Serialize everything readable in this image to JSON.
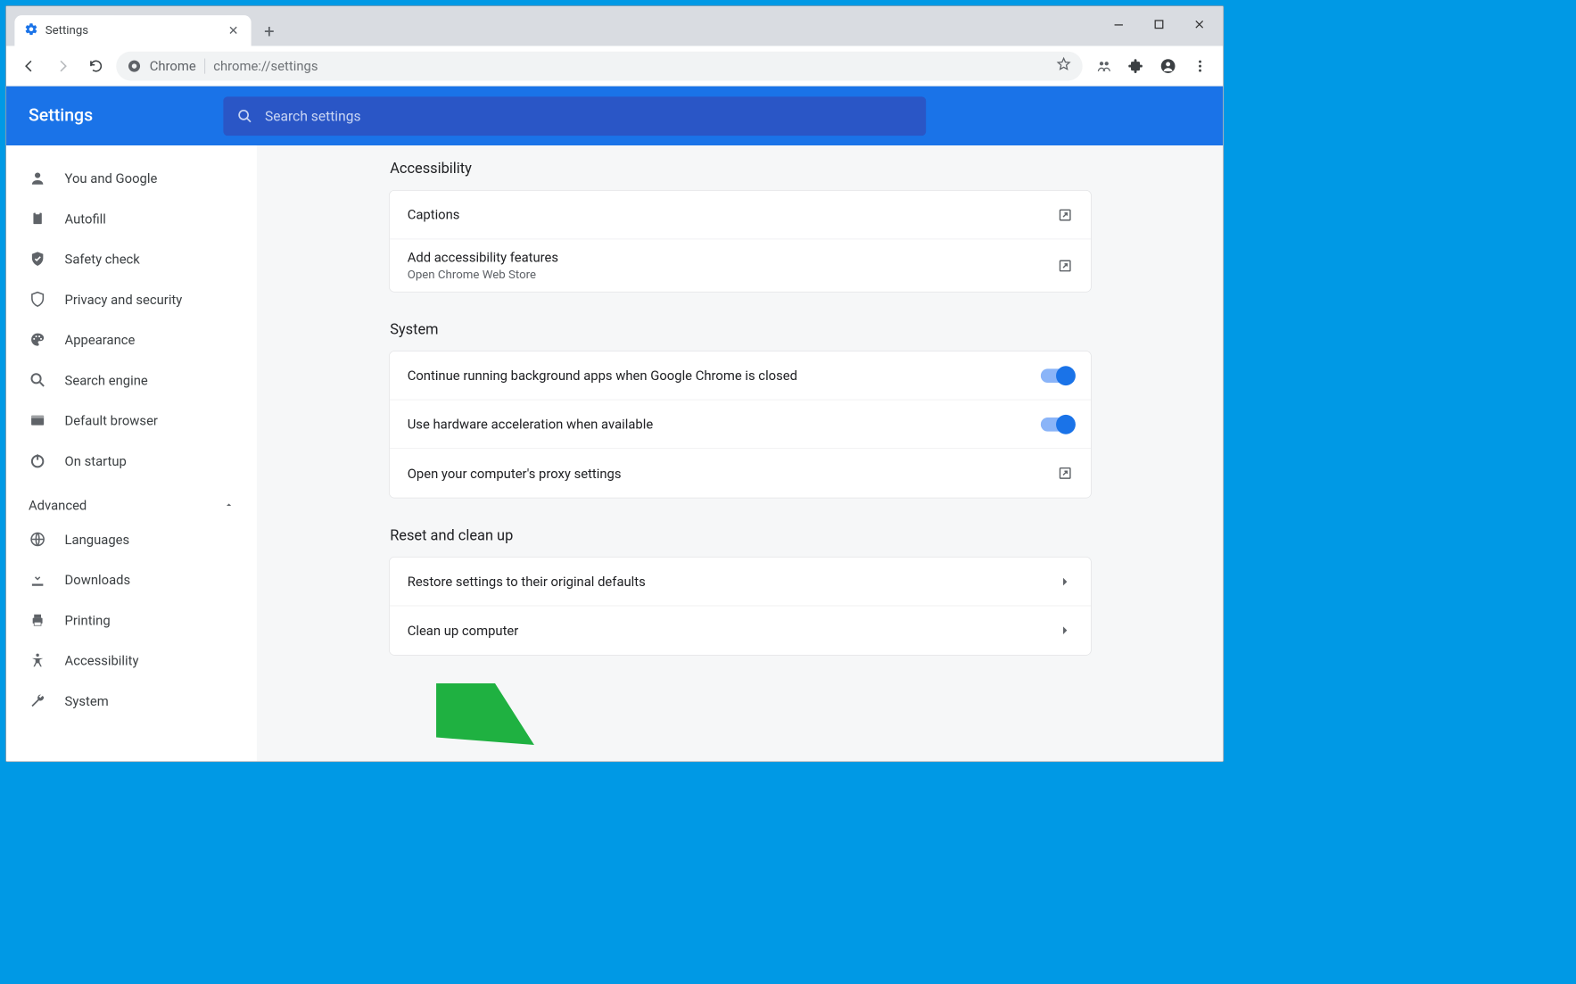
{
  "tab": {
    "title": "Settings"
  },
  "addressbar": {
    "label": "Chrome",
    "url": "chrome://settings"
  },
  "header": {
    "title": "Settings",
    "search_placeholder": "Search settings"
  },
  "sidebar": {
    "items": [
      {
        "label": "You and Google"
      },
      {
        "label": "Autofill"
      },
      {
        "label": "Safety check"
      },
      {
        "label": "Privacy and security"
      },
      {
        "label": "Appearance"
      },
      {
        "label": "Search engine"
      },
      {
        "label": "Default browser"
      },
      {
        "label": "On startup"
      }
    ],
    "advanced_label": "Advanced",
    "advanced_items": [
      {
        "label": "Languages"
      },
      {
        "label": "Downloads"
      },
      {
        "label": "Printing"
      },
      {
        "label": "Accessibility"
      },
      {
        "label": "System"
      }
    ]
  },
  "content": {
    "accessibility": {
      "title": "Accessibility",
      "captions": "Captions",
      "add_features": "Add accessibility features",
      "add_features_sub": "Open Chrome Web Store"
    },
    "system": {
      "title": "System",
      "bg_apps": "Continue running background apps when Google Chrome is closed",
      "hw_accel": "Use hardware acceleration when available",
      "proxy": "Open your computer's proxy settings"
    },
    "reset": {
      "title": "Reset and clean up",
      "restore": "Restore settings to their original defaults",
      "cleanup": "Clean up computer"
    }
  }
}
